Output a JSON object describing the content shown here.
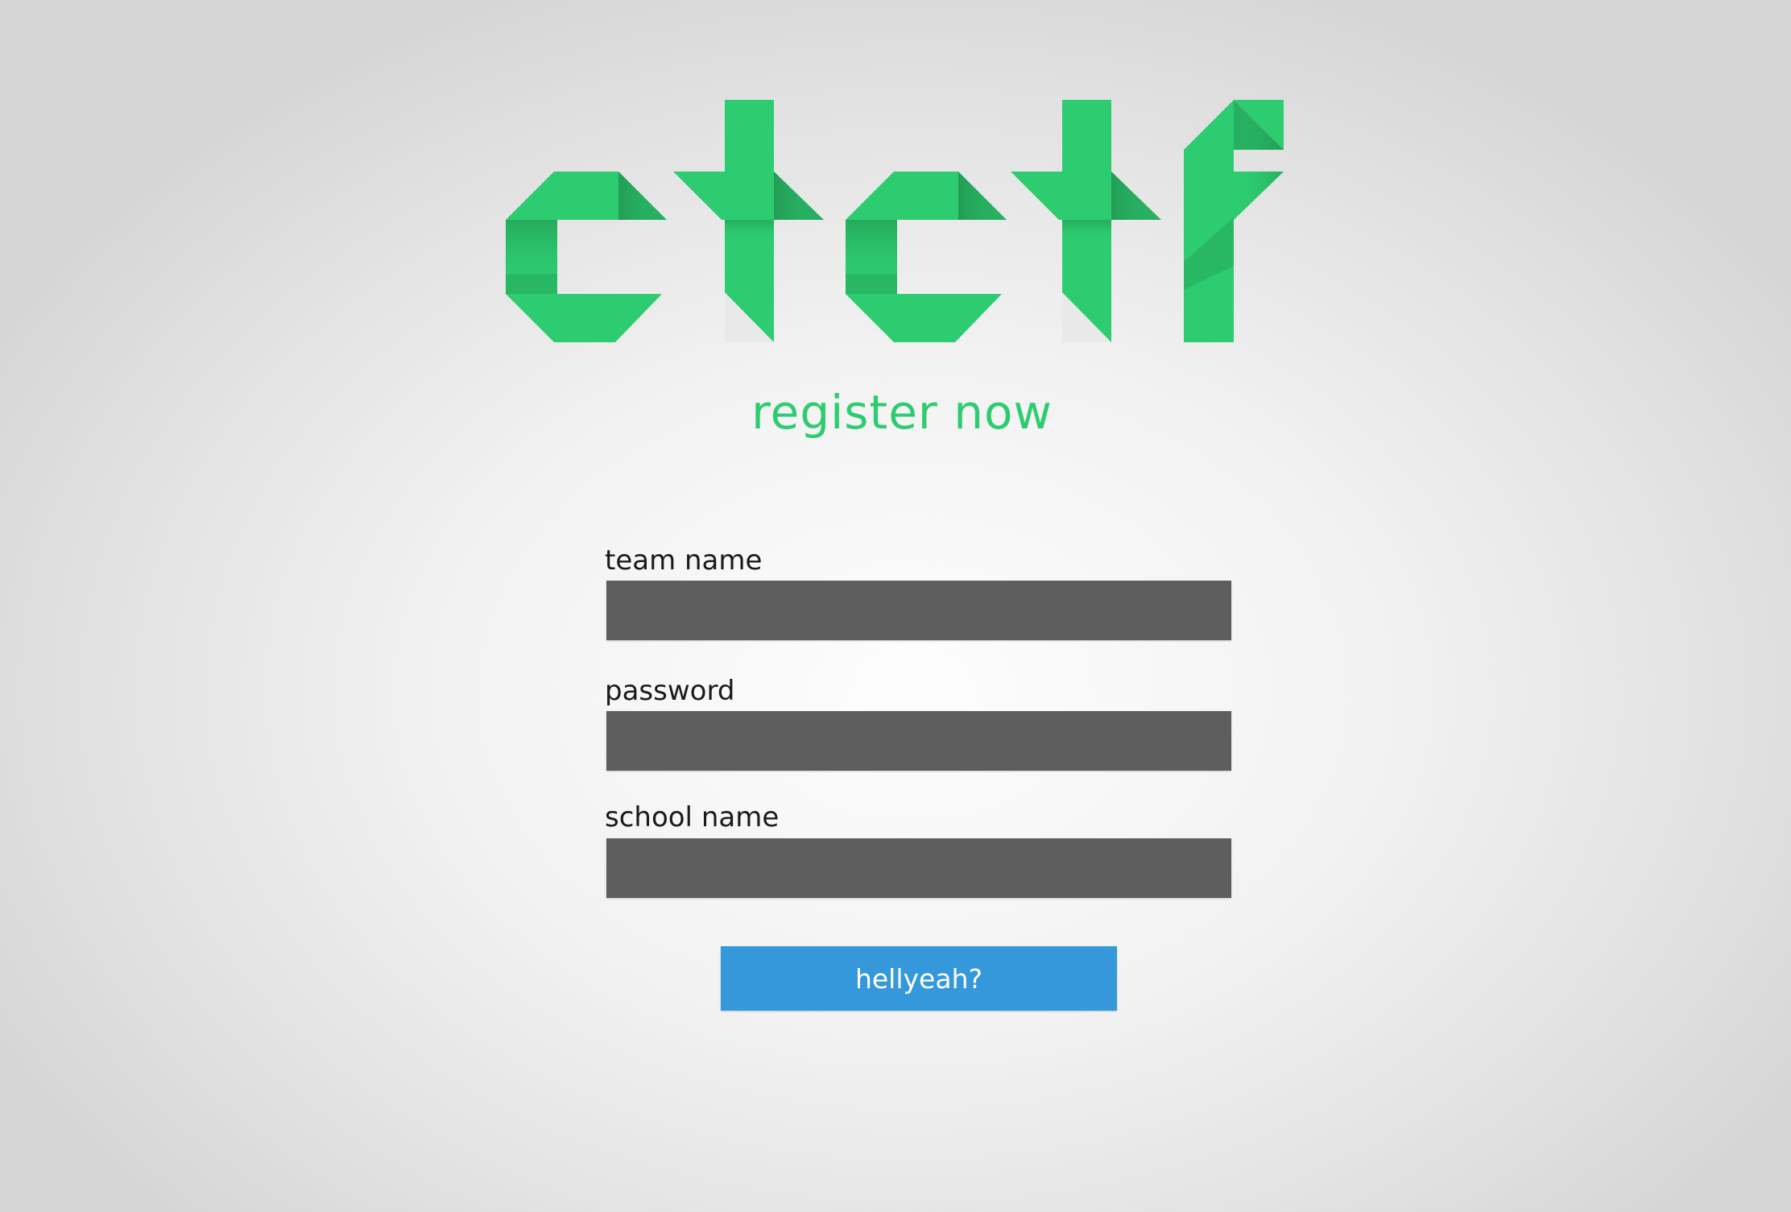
{
  "logo": {
    "text": "ctctf",
    "color": "#2ecc71",
    "shade_color": "#25a85a",
    "fold_color": "#27ae60"
  },
  "subtitle": "register now",
  "form": {
    "fields": [
      {
        "label": "team name",
        "value": "",
        "placeholder": ""
      },
      {
        "label": "password",
        "value": "",
        "placeholder": ""
      },
      {
        "label": "school name",
        "value": "",
        "placeholder": ""
      }
    ],
    "submit_label": "hellyeah?"
  },
  "colors": {
    "accent_green": "#2ecc71",
    "input_bg": "#5e5e5e",
    "button_blue": "#3498db",
    "label_text": "#1a1a1a"
  }
}
